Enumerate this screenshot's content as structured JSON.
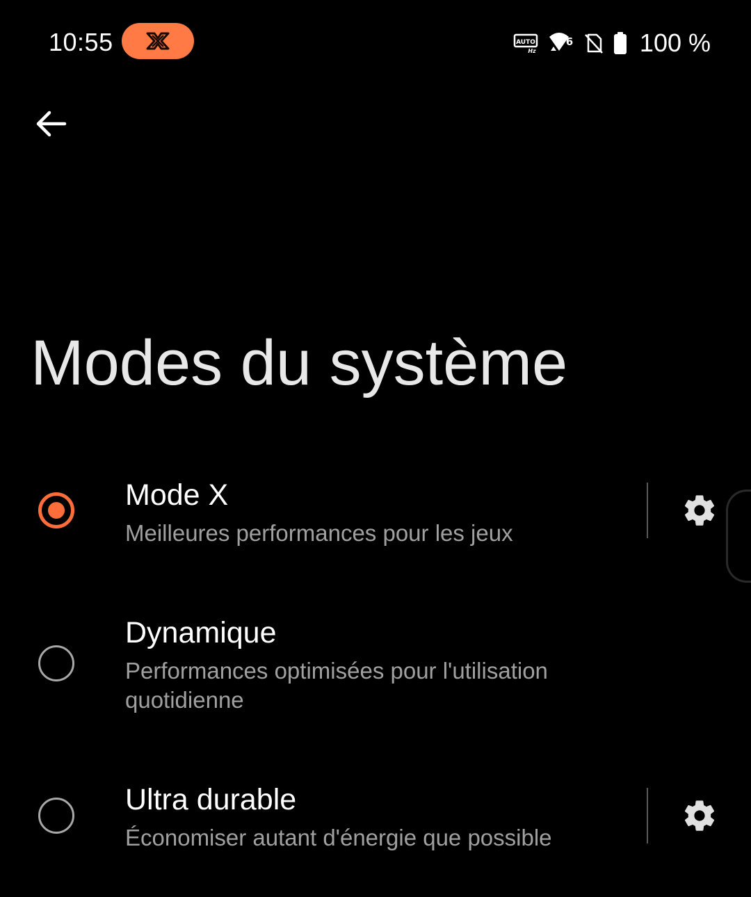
{
  "status_bar": {
    "time": "10:55",
    "xmode_badge_icon": "x-mode-icon",
    "icons": [
      "auto-hz-icon",
      "wifi-6-icon",
      "no-sim-icon",
      "battery-full-icon"
    ],
    "auto_hz_label": "AUTO",
    "hz_label": "Hz",
    "wifi_label": "6",
    "battery_text": "100 %"
  },
  "header": {
    "back_icon": "back-arrow-icon",
    "title": "Modes du système"
  },
  "options": [
    {
      "title": "Mode X",
      "subtitle": "Meilleures performances pour les jeux",
      "selected": true,
      "has_settings": true
    },
    {
      "title": "Dynamique",
      "subtitle": "Performances optimisées pour l'utilisation quotidienne",
      "selected": false,
      "has_settings": false
    },
    {
      "title": "Ultra durable",
      "subtitle": "Économiser autant d'énergie que possible",
      "selected": false,
      "has_settings": true
    }
  ],
  "colors": {
    "accent": "#ff6e3a",
    "badge": "#ff7a45",
    "background": "#000000",
    "subtitle": "#a0a0a0"
  }
}
